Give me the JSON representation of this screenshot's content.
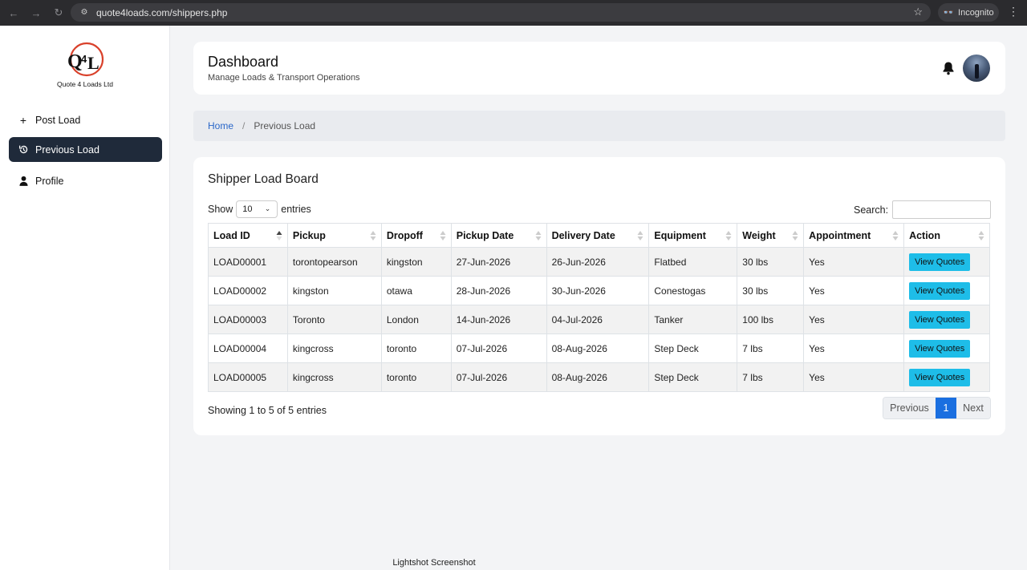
{
  "browser": {
    "url": "quote4loads.com/shippers.php",
    "incognito_label": "Incognito"
  },
  "logo": {
    "text": "Quote 4 Loads Ltd"
  },
  "sidebar": {
    "items": [
      {
        "label": "Post Load",
        "icon": "plus-icon",
        "active": false
      },
      {
        "label": "Previous Load",
        "icon": "history-icon",
        "active": true
      },
      {
        "label": "Profile",
        "icon": "user-icon",
        "active": false
      }
    ]
  },
  "header": {
    "title": "Dashboard",
    "subtitle": "Manage Loads & Transport Operations"
  },
  "breadcrumb": {
    "home": "Home",
    "separator": "/",
    "current": "Previous Load"
  },
  "board": {
    "title": "Shipper Load Board",
    "show_label": "Show",
    "entries_label": "entries",
    "page_size": "10",
    "search_label": "Search:",
    "search_value": "",
    "columns": [
      "Load ID",
      "Pickup",
      "Dropoff",
      "Pickup Date",
      "Delivery Date",
      "Equipment",
      "Weight",
      "Appointment",
      "Action"
    ],
    "rows": [
      [
        "LOAD00001",
        "torontopearson",
        "kingston",
        "27-Jun-2026",
        "26-Jun-2026",
        "Flatbed",
        "30 lbs",
        "Yes",
        "View Quotes"
      ],
      [
        "LOAD00002",
        "kingston",
        "otawa",
        "28-Jun-2026",
        "30-Jun-2026",
        "Conestogas",
        "30 lbs",
        "Yes",
        "View Quotes"
      ],
      [
        "LOAD00003",
        "Toronto",
        "London",
        "14-Jun-2026",
        "04-Jul-2026",
        "Tanker",
        "100 lbs",
        "Yes",
        "View Quotes"
      ],
      [
        "LOAD00004",
        "kingcross",
        "toronto",
        "07-Jul-2026",
        "08-Aug-2026",
        "Step Deck",
        "7 lbs",
        "Yes",
        "View Quotes"
      ],
      [
        "LOAD00005",
        "kingcross",
        "toronto",
        "07-Jul-2026",
        "08-Aug-2026",
        "Step Deck",
        "7 lbs",
        "Yes",
        "View Quotes"
      ]
    ],
    "showing_text": "Showing 1 to 5 of 5 entries",
    "pager": {
      "previous": "Previous",
      "current": "1",
      "next": "Next"
    }
  },
  "overlay": {
    "lightshot": "Lightshot Screenshot"
  },
  "colors": {
    "sidebar_active": "#1f2a3a",
    "link": "#2a67c9",
    "action_button": "#1ebde8",
    "pager_active": "#1a6fe0"
  }
}
